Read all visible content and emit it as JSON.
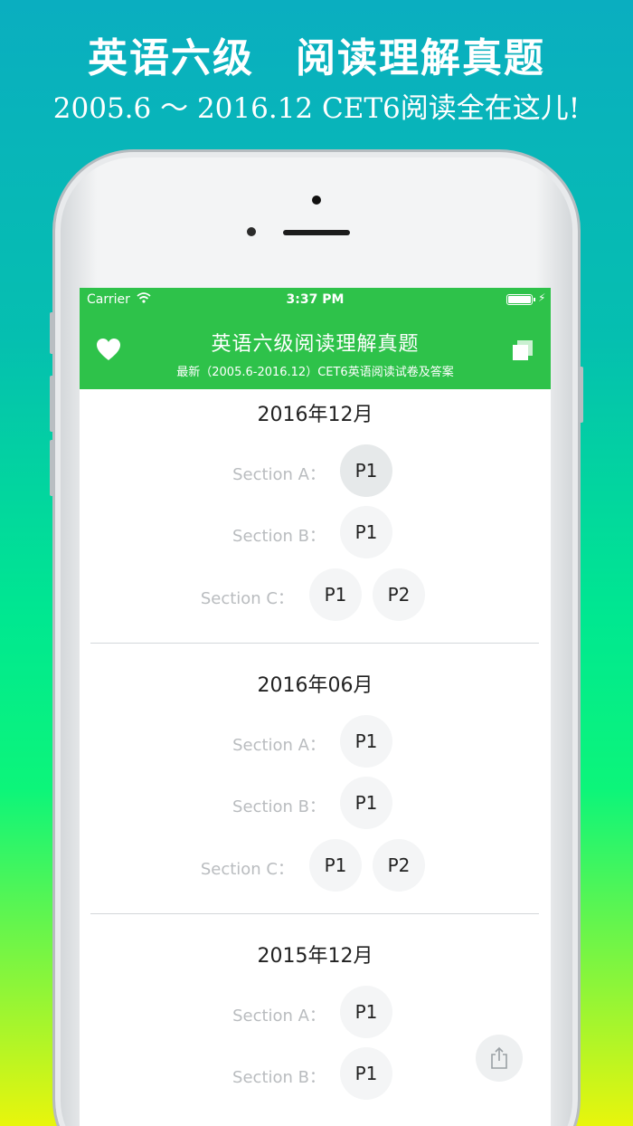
{
  "promo": {
    "title": "英语六级　阅读理解真题",
    "subtitle": "2005.6 ～ 2016.12  CET6阅读全在这儿!"
  },
  "status_bar": {
    "carrier": "Carrier",
    "time": "3:37 PM"
  },
  "navbar": {
    "title": "英语六级阅读理解真题",
    "subtitle": "最新（2005.6-2016.12）CET6英语阅读试卷及答案",
    "left_icon": "heart-icon",
    "right_icon": "copy-icon"
  },
  "colors": {
    "accent": "#2ec24a",
    "label_gray": "#b9bcbf"
  },
  "exams": [
    {
      "date": "2016年12月",
      "sections": [
        {
          "label": "Section A：",
          "parts": [
            "P1"
          ]
        },
        {
          "label": "Section B：",
          "parts": [
            "P1"
          ]
        },
        {
          "label": "Section C：",
          "parts": [
            "P1",
            "P2"
          ]
        }
      ]
    },
    {
      "date": "2016年06月",
      "sections": [
        {
          "label": "Section A：",
          "parts": [
            "P1"
          ]
        },
        {
          "label": "Section B：",
          "parts": [
            "P1"
          ]
        },
        {
          "label": "Section C：",
          "parts": [
            "P1",
            "P2"
          ]
        }
      ]
    },
    {
      "date": "2015年12月",
      "sections": [
        {
          "label": "Section A：",
          "parts": [
            "P1"
          ]
        },
        {
          "label": "Section B：",
          "parts": [
            "P1"
          ]
        }
      ]
    }
  ],
  "share_icon": "share-icon"
}
